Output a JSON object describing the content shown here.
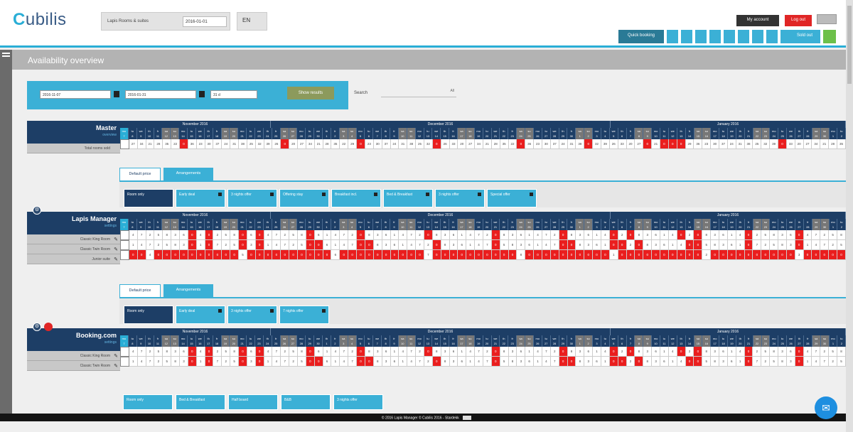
{
  "app": {
    "logo": "Cubilis"
  },
  "header": {
    "property_name": "Lapis Rooms & suites",
    "date": "2016-01-01",
    "lang": "EN",
    "account_label": "My account",
    "logout_label": "Log out",
    "toolbar": [
      "Quick booking",
      "",
      "",
      "",
      "",
      "",
      "",
      "",
      "",
      "",
      "Sold out",
      ""
    ]
  },
  "page": {
    "title": "Availability overview"
  },
  "filter": {
    "start": "2016-11-07",
    "end": "2016-01-31",
    "period": "31 d",
    "show_label": "Show results",
    "search_label": "Search",
    "search_placeholder": "All"
  },
  "months": [
    "November 2016",
    "December 2016",
    "January 2016"
  ],
  "master": {
    "name": "Master",
    "sub": "overview",
    "row_label": "Total rooms sold"
  },
  "tabs": {
    "default": "Default price",
    "arrangements": "Arrangements"
  },
  "plans_a": [
    "Room only",
    "Early deal",
    "3 nights offer",
    "Offering stay",
    "Breakfast incl.",
    "Bed & Breakfast",
    "3 nights offer",
    "Special offer"
  ],
  "channel_a": {
    "name": "Lapis Manager",
    "sub": "settings",
    "rows": [
      "Classic King Room",
      "Classic Twin Room",
      "Junior suite"
    ]
  },
  "plans_b": [
    "Room only",
    "Early deal",
    "3 nights offer",
    "7 nights offer"
  ],
  "channel_b": {
    "name": "Booking.com",
    "sub": "settings",
    "rows": [
      "Classic King Room",
      "Classic Twin Room"
    ]
  },
  "plans_c": [
    "Room only",
    "Bed & Breakfast",
    "Half board",
    "B&B",
    "3 nights offer"
  ],
  "footer": {
    "text": "© 2016 Lapis Manager © Cubilis 2016 - Stardekk"
  },
  "colors": {
    "navy": "#1d3e66",
    "cyan": "#3bb0d6",
    "red": "#ea1e1e",
    "grey": "#b3b3b3"
  }
}
